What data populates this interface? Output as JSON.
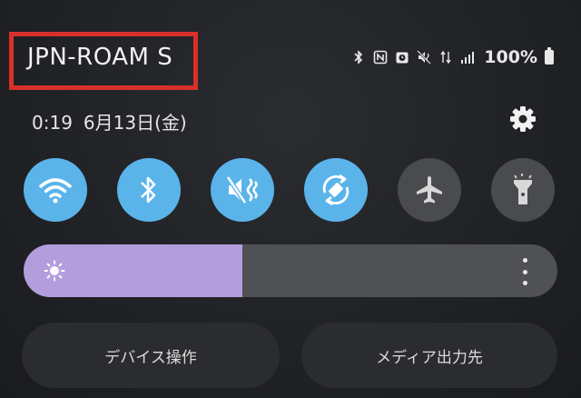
{
  "status_bar": {
    "carrier": "JPN-ROAM S",
    "battery": "100%",
    "icons": [
      "bluetooth-icon",
      "nfc-icon",
      "alarm-icon",
      "mute-icon",
      "data-arrows-icon",
      "signal-icon",
      "battery-icon"
    ]
  },
  "header": {
    "time": "0:19",
    "date": "6月13日(金)",
    "settings_icon": "gear-icon"
  },
  "quick_tiles": [
    {
      "name": "wifi",
      "icon": "wifi-icon",
      "active": true
    },
    {
      "name": "bluetooth",
      "icon": "bluetooth-icon",
      "active": true
    },
    {
      "name": "sound",
      "icon": "mute-vibrate-icon",
      "active": true
    },
    {
      "name": "auto-rotate",
      "icon": "rotate-icon",
      "active": true
    },
    {
      "name": "airplane",
      "icon": "airplane-icon",
      "active": false
    },
    {
      "name": "flashlight",
      "icon": "flashlight-icon",
      "active": false
    }
  ],
  "brightness": {
    "level_percent": 41,
    "icon": "sun-icon",
    "fill_color": "#b39ddc"
  },
  "buttons": {
    "device_control": "デバイス操作",
    "media_output": "メディア出力先"
  },
  "colors": {
    "tile_active": "#5ab4ea",
    "tile_inactive": "#4a4b4e",
    "highlight_box": "#d8302b"
  }
}
